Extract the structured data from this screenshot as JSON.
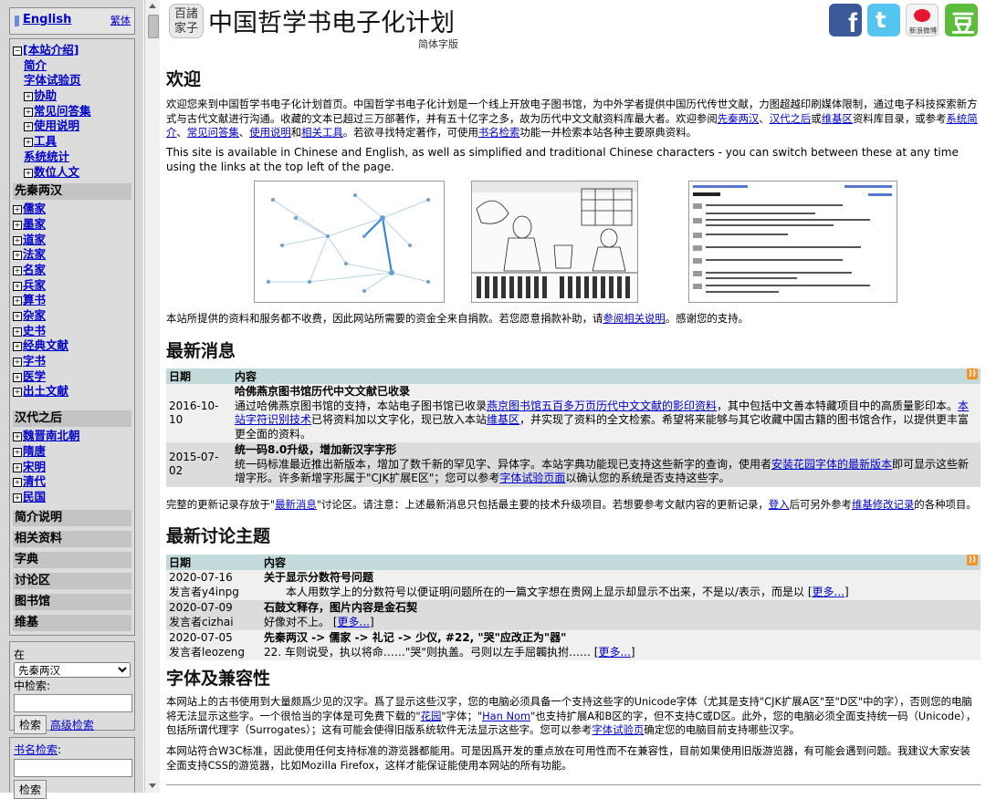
{
  "lang": {
    "english": "English",
    "traditional": "繁体"
  },
  "nav": {
    "intro": "[本站介绍]",
    "intro_items": [
      "简介",
      "字体试验页",
      "协助",
      "常见问答集",
      "使用说明",
      "工具",
      "系统统计",
      "数位人文"
    ],
    "pre_qin_title": "先秦两汉",
    "pre_qin_items": [
      "儒家",
      "墨家",
      "道家",
      "法家",
      "名家",
      "兵家",
      "算书",
      "杂家",
      "史书",
      "经典文献",
      "字书",
      "医学",
      "出土文献"
    ],
    "han_after_title": "汉代之后",
    "han_after_items": [
      "魏晋南北朝",
      "隋唐",
      "宋明",
      "清代",
      "民国"
    ],
    "plain_items": [
      "简介说明",
      "相关资料",
      "字典",
      "讨论区",
      "图书馆",
      "维基"
    ]
  },
  "search": {
    "in_label": "在",
    "select_value": "先秦两汉",
    "mid_label": "中检索:",
    "search_button": "检索",
    "advanced_link": "高级检索",
    "book_search_link": "书名检索",
    "book_search_colon": ":",
    "book_search_button": "检索"
  },
  "header": {
    "logo_text": "百諸家子",
    "title": "中国哲学书电子化计划",
    "subtitle": "简体字版",
    "social": {
      "facebook": "f",
      "twitter": "t",
      "weibo": "新浪微博",
      "douban": "豆"
    }
  },
  "welcome": {
    "heading": "欢迎",
    "p1_a": "欢迎您来到中国哲学书电子化计划首页。中国哲学书电子化计划是一个线上开放电子图书馆，为中外学者提供中国历代传世文献，力图超越印刷媒体限制，通过电子科技探索新方式与古代文献进行沟通。收藏的文本已超过三万部著作，并有五十亿字之多，故为历代中文文献资料库最大者。欢迎参阅",
    "p1_link1": "先秦两汉",
    "p1_sep1": "、",
    "p1_link2": "汉代之后",
    "p1_or": "或",
    "p1_link3": "维基区",
    "p1_b": "资料库目录，或参考",
    "p1_link4": "系统简介",
    "p1_sep2": "、",
    "p1_link5": "常见问答集",
    "p1_sep3": "、",
    "p1_link6": "使用说明",
    "p1_and": "和",
    "p1_link7": "相关工具",
    "p1_c": "。若欲寻找特定著作，可使用",
    "p1_link8": "书名检索",
    "p1_d": "功能一并检索本站各种主要原典资料。",
    "p2": "This site is available in Chinese and English, as well as simplified and traditional Chinese characters - you can switch between these at any time using the links at the top left of the page.",
    "p3_a": "本站所提供的资料和服务都不收费，因此网站所需要的资金全来自捐款。若您愿意捐款补助，请",
    "p3_link": "参阅相关说明",
    "p3_b": "。感谢您的支持。"
  },
  "news": {
    "heading": "最新消息",
    "col_date": "日期",
    "col_content": "内容",
    "rows": [
      {
        "date": "2016-10-10",
        "title": "哈佛燕京图书馆历代中文文献已收录",
        "body_a": "通过哈佛燕京图书馆的支持，本站电子图书馆已收录",
        "link1": "燕京图书馆五百多万页历代中文文献的影印资料",
        "body_b": "，其中包括中文善本特藏项目中的高质量影印本。",
        "link2": "本站字符识别技术",
        "body_c": "已将资料加以文字化，现已放入本站",
        "link3": "维基区",
        "body_d": "，并实现了资料的全文检索。希望将来能够与其它收藏中国古籍的图书馆合作，以提供更丰富更全面的资料。"
      },
      {
        "date": "2015-07-02",
        "title": "统一码8.0升级，增加新汉字字形",
        "body_a": "统一码标准最近推出新版本，增加了数千新的罕见字、异体字。本站字典功能现已支持这些新字的查询，使用者",
        "link1": "安装花园字体的最新版本",
        "body_b": "即可显示这些新增字形。许多新增字形属于\"CJK扩展E区\"；您可以参考",
        "link2": "字体试验页面",
        "body_c": "以确认您的系统是否支持这些字。"
      }
    ],
    "footer_a": "完整的更新记录存放于\"",
    "footer_link1": "最新消息",
    "footer_b": "\"讨论区。请注意：上述最新消息只包括最主要的技术升级项目。若想要参考文献内容的更新记录，",
    "footer_link2": "登入",
    "footer_c": "后可另外参考",
    "footer_link3": "维基修改记录",
    "footer_d": "的各种项目。"
  },
  "discussion": {
    "heading": "最新讨论主题",
    "col_date": "日期",
    "col_content": "内容",
    "rows": [
      {
        "date": "2020-07-16",
        "poster": "发言者y4inpg",
        "title": "关于显示分数符号问题",
        "body": "　　本人用数学上的分数符号以便证明问题所在的一篇文字想在贵网上显示却显示不出来，不是以/表示，而是以 [",
        "more": "更多...",
        "end": "]"
      },
      {
        "date": "2020-07-09",
        "poster": "发言者cizhai",
        "title": "石鼓文释存，图片内容是金石契",
        "body": "好像对不上。 [",
        "more": "更多...",
        "end": "]"
      },
      {
        "date": "2020-07-05",
        "poster": "发言者leozeng",
        "title": "先秦两汉 -> 儒家 -> 礼记 -> 少仪, #22, \"哭\"应改正为\"器\"",
        "body": "22. 车则说受，执以将命……\"哭\"则执盖。弓则以左手屈韣执拊…… [",
        "more": "更多...",
        "end": "]"
      }
    ]
  },
  "fonts": {
    "heading": "字体及兼容性",
    "p1_a": "本网站上的古书使用到大量颇爲少见的汉字。爲了显示这些汉字，您的电脑必须具备一个支持这些字的Unicode字体（尤其是支持\"CJK扩展A区\"至\"D区\"中的字），否则您的电脑将无法显示这些字。一个很恰当的字体是可免费下载的\"",
    "p1_link1": "花园",
    "p1_b": "\"字体；\"",
    "p1_link2": "Han Nom",
    "p1_c": "\"也支持扩展A和B区的字，但不支持C或D区。此外，您的电脑必须全面支持统一码（Unicode），包括所谓代理字（Surrogates）；这有可能会使得旧版系统软件无法显示这些字。您可以参考",
    "p1_link3": "字体试验页",
    "p1_d": "确定您的电脑目前支持哪些汉字。",
    "p2": "本网站符合W3C标准，因此使用任何支持标准的游览器都能用。可是因爲开发的重点放在可用性而不在兼容性，目前如果使用旧版游览器，有可能会遇到问题。我建议大家安装全面支持CSS的游览器，比如Mozilla Firefox，这样才能保证能使用本网站的所有功能。"
  },
  "colors": {
    "link": "#0000cc",
    "table_header": "#c3dada",
    "row_light": "#f0f0f0",
    "row_dark": "#dcdcdc",
    "sidebar": "#d8d8d8"
  }
}
